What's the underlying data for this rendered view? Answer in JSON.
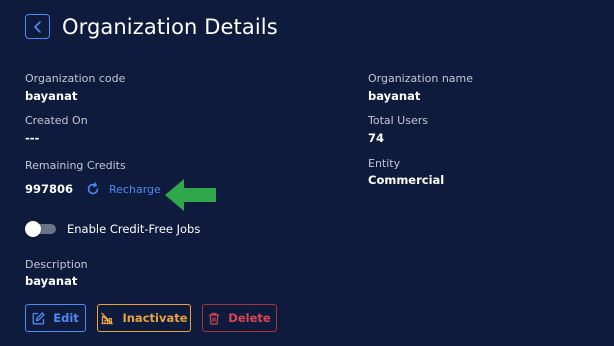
{
  "header": {
    "title": "Organization Details"
  },
  "fields": {
    "organization_code": {
      "label": "Organization code",
      "value": "bayanat"
    },
    "organization_name": {
      "label": "Organization name",
      "value": "bayanat"
    },
    "created_on": {
      "label": "Created On",
      "value": "---"
    },
    "total_users": {
      "label": "Total Users",
      "value": "74"
    },
    "remaining_credits": {
      "label": "Remaining Credits",
      "value": "997806"
    },
    "entity": {
      "label": "Entity",
      "value": "Commercial"
    },
    "description": {
      "label": "Description",
      "value": "bayanat"
    }
  },
  "recharge": {
    "label": "Recharge"
  },
  "credit_free_toggle": {
    "label": "Enable Credit-Free Jobs",
    "enabled": false
  },
  "actions": {
    "edit_label": "Edit",
    "inactivate_label": "Inactivate",
    "delete_label": "Delete"
  },
  "icons": {
    "back": "chevron-left-icon",
    "recharge": "refresh-icon",
    "annotation": "arrow-left-icon",
    "edit": "edit-icon",
    "inactivate": "inactivate-icon",
    "delete": "trash-icon"
  },
  "colors": {
    "background": "#0f1b3d",
    "accent": "#4d8bf5",
    "warning": "#e8a33d",
    "danger": "#d9474f",
    "annotation": "#2ea84a"
  }
}
